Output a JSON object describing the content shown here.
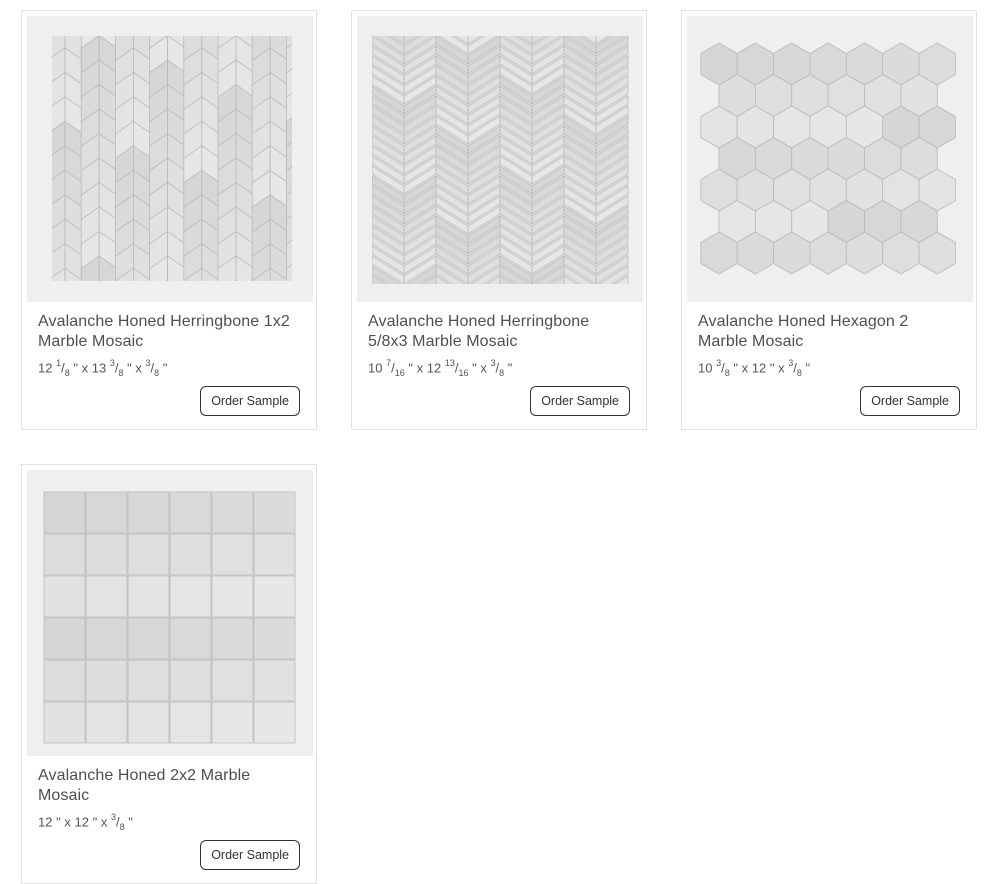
{
  "products": [
    {
      "name": "Avalanche Honed Herringbone 1x2 Marble Mosaic",
      "dims": {
        "w_int": "12",
        "w_num": "1",
        "w_den": "8",
        "l_int": "13",
        "l_num": "3",
        "l_den": "8",
        "t_num": "3",
        "t_den": "8"
      },
      "button": "Order Sample",
      "pattern": "herringbone"
    },
    {
      "name": "Avalanche Honed Herringbone 5/8x3 Marble Mosaic",
      "dims": {
        "w_int": "10",
        "w_num": "7",
        "w_den": "16",
        "l_int": "12",
        "l_num": "13",
        "l_den": "16",
        "t_num": "3",
        "t_den": "8"
      },
      "button": "Order Sample",
      "pattern": "herringbone-thin"
    },
    {
      "name": "Avalanche Honed Hexagon 2 Marble Mosaic",
      "dims": {
        "w_int": "10",
        "w_num": "3",
        "w_den": "8",
        "l_int": "12",
        "t_num": "3",
        "t_den": "8"
      },
      "button": "Order Sample",
      "pattern": "hexagon"
    },
    {
      "name": "Avalanche Honed 2x2 Marble Mosaic",
      "dims": {
        "w_int": "12",
        "l_int": "12",
        "t_num": "3",
        "t_den": "8"
      },
      "button": "Order Sample",
      "pattern": "square"
    }
  ],
  "unit_mark": "\"",
  "times": "x",
  "frac_sep": "/",
  "colors": {
    "tile": "#dedede",
    "tile_edge": "#b9b9b9",
    "grout": "#9a9a9a",
    "bg": "#efefef",
    "button_border": "#333333"
  }
}
